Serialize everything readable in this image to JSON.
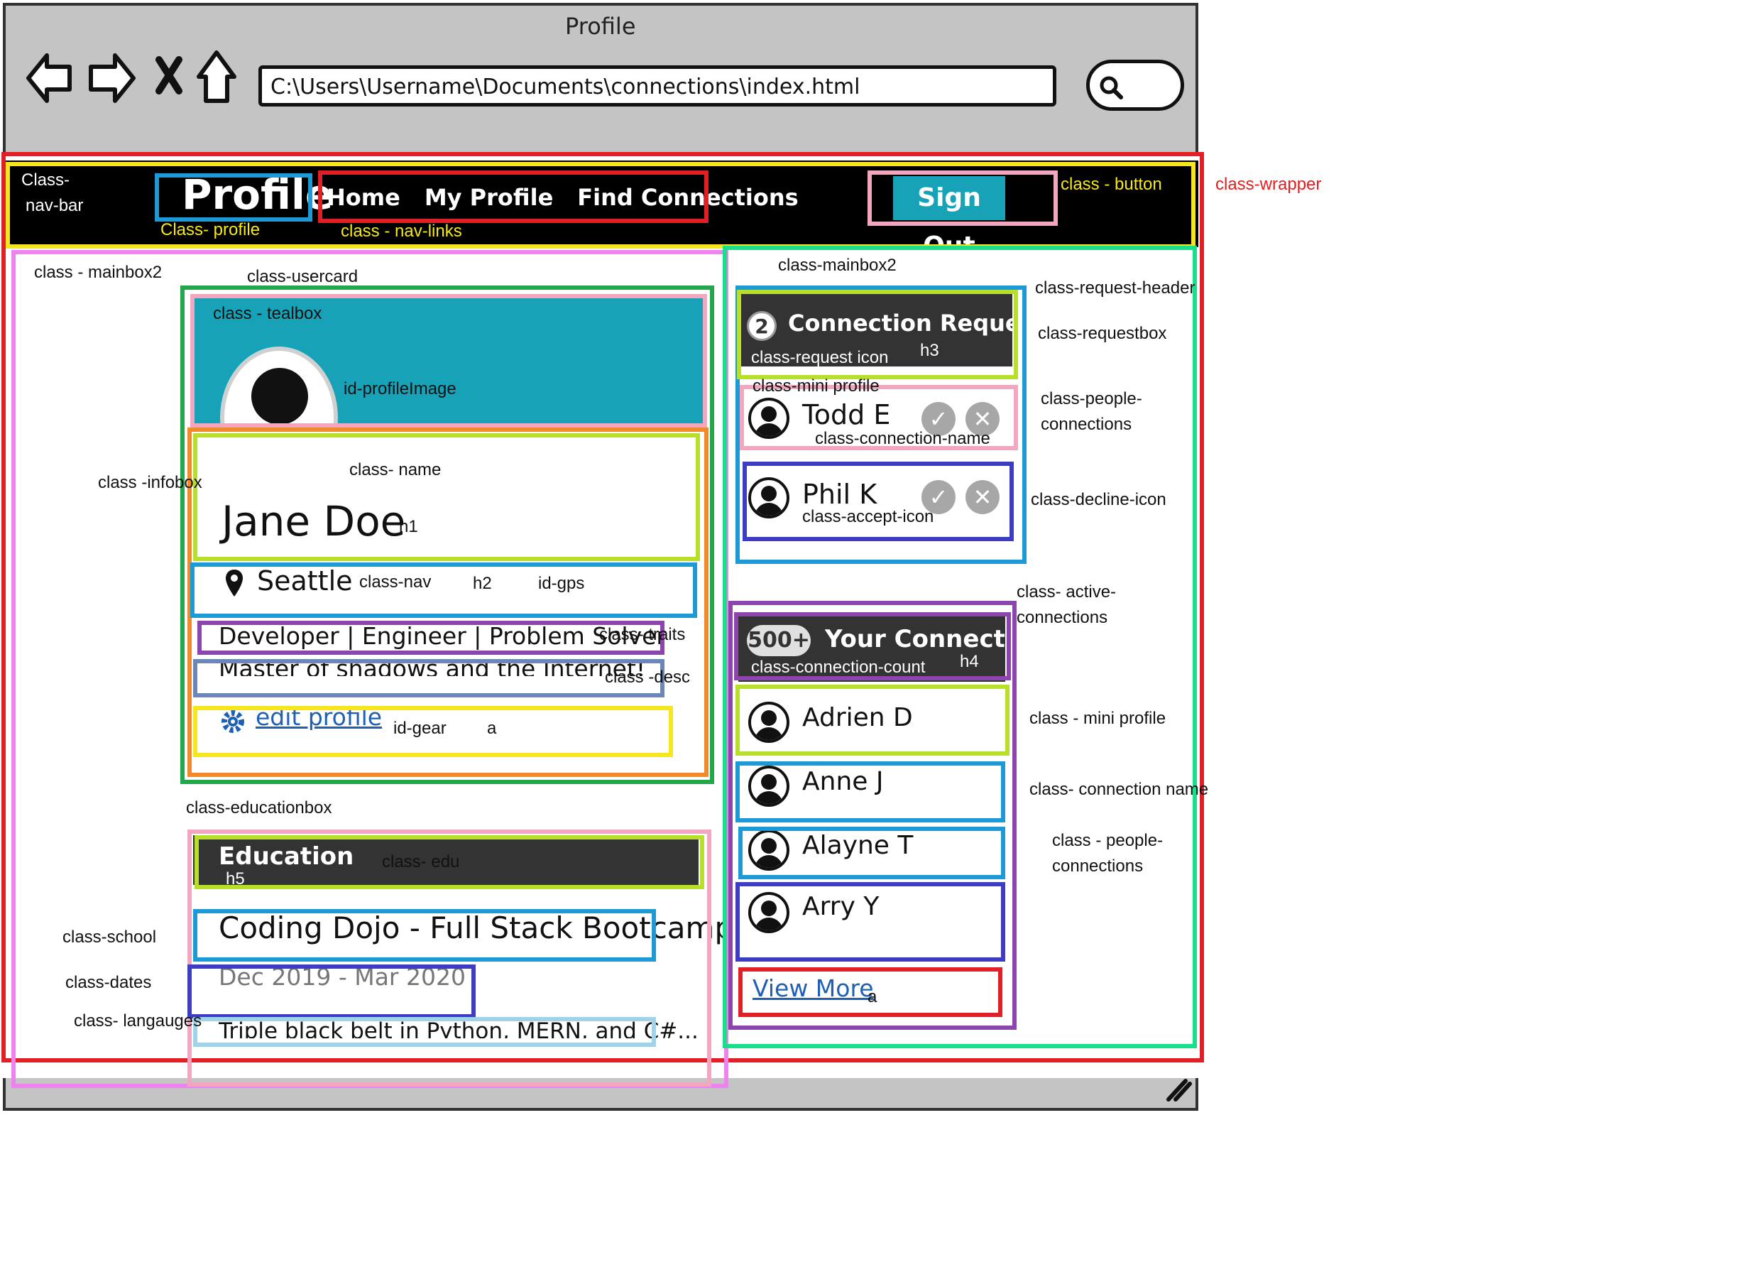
{
  "browser": {
    "title": "Profile",
    "address": "C:\\Users\\Username\\Documents\\connections\\index.html"
  },
  "nav": {
    "brand": "Profile",
    "links": [
      "Home",
      "My Profile",
      "Find Connections"
    ],
    "signout": "Sign Out"
  },
  "usercard": {
    "name": "Jane Doe",
    "location": "Seattle",
    "traits": "Developer | Engineer | Problem Solver",
    "desc": "Master of shadows and the Internet!",
    "edit": "edit profile"
  },
  "education": {
    "header": "Education",
    "school": "Coding Dojo - Full Stack Bootcamp",
    "dates": "Dec 2019 - Mar 2020",
    "languages": "Triple black belt in Python, MERN, and C#..."
  },
  "requests": {
    "count": "2",
    "title": "Connection Requests",
    "people": [
      "Todd E",
      "Phil K"
    ]
  },
  "connections": {
    "count": "500+",
    "title": "Your Connections",
    "people": [
      "Adrien D",
      "Anne J",
      "Alayne T",
      "Arry Y"
    ],
    "view_more": "View More"
  },
  "annotations": {
    "navbar_1": "Class-",
    "navbar_2": "nav-bar",
    "profile": "Class- profile",
    "navlinks": "class - nav-links",
    "button": "class - button",
    "wrapper": "class-wrapper",
    "mainbox2_left": "class - mainbox2",
    "usercard": "class-usercard",
    "tealbox": "class - tealbox",
    "profile_image": "id-profileImage",
    "infobox": "class -infobox",
    "name": "class- name",
    "h1": "h1",
    "nav": "class-nav",
    "h2": "h2",
    "gps": "id-gps",
    "traits": "class- traits",
    "desc": "class -desc",
    "gear": "id-gear",
    "a1": "a",
    "educationbox": "class-educationbox",
    "edu": "class- edu",
    "h5": "h5",
    "school": "class-school",
    "dates": "class-dates",
    "languages": "class- langauges",
    "mainbox2_right": "class-mainbox2",
    "request_header": "class-request-header",
    "requestbox": "class-requestbox",
    "request_icon": "class-request icon",
    "h3": "h3",
    "mini_profile_1": "class-mini profile",
    "people_connections_1a": "class-people-",
    "people_connections_1b": "connections",
    "connection_name_1": "class-connection-name",
    "decline_icon": "class-decline-icon",
    "accept_icon": "class-accept-icon",
    "active_connections_a": "class- active-",
    "active_connections_b": "connections",
    "connection_count": "class-connection-count",
    "h4": "h4",
    "mini_profile_2": "class - mini profile",
    "connection_name_2": "class- connection name",
    "people_connections_2a": "class - people-",
    "people_connections_2b": "connections",
    "a2": "a"
  },
  "colors": {
    "teal": "#17a2b8",
    "dark": "#333333",
    "navbar": "#000000",
    "chrome": "#c4c4c4"
  }
}
